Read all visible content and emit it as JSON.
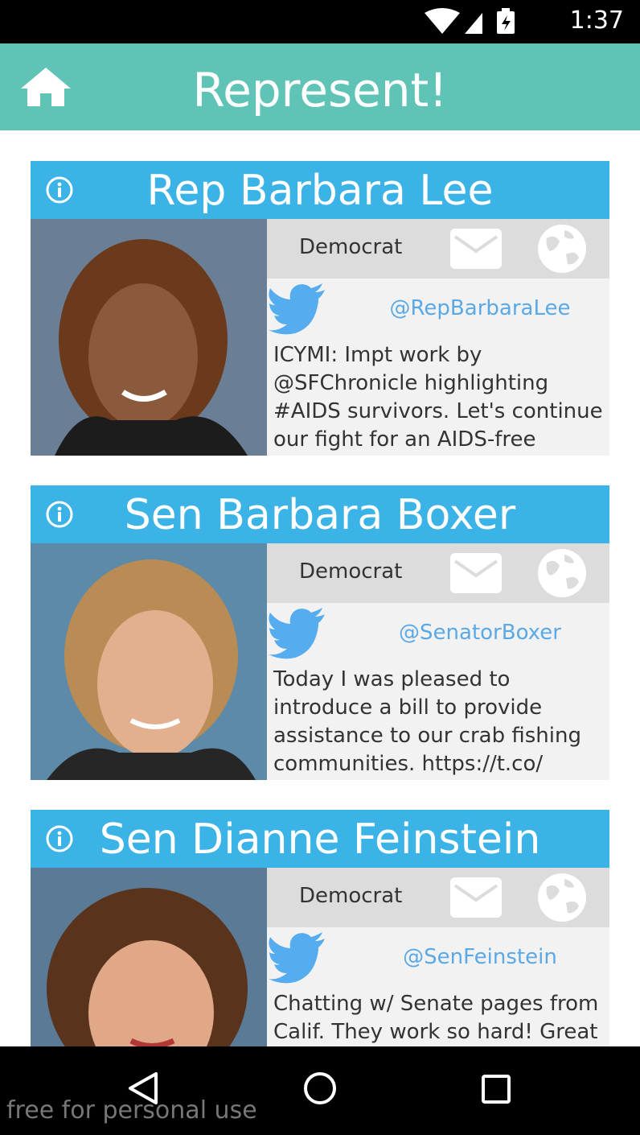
{
  "status_bar": {
    "time": "1:37"
  },
  "app_bar": {
    "title": "Represent!"
  },
  "cards": [
    {
      "name": "Rep Barbara Lee",
      "party": "Democrat",
      "handle": "@RepBarbaraLee",
      "tweet": "ICYMI: Impt work by @SFChronicle highlighting #AIDS survivors. Let's continue our fight for an AIDS-free"
    },
    {
      "name": "Sen Barbara Boxer",
      "party": "Democrat",
      "handle": "@SenatorBoxer",
      "tweet": "Today I was pleased to introduce a bill to provide assistance to our crab fishing communities. https://t.co/"
    },
    {
      "name": "Sen Dianne Feinstein",
      "party": "Democrat",
      "handle": "@SenFeinstein",
      "tweet": "Chatting w/ Senate pages from Calif. They work so hard! Great"
    }
  ],
  "watermark": "free for personal use",
  "colors": {
    "app_bar": "#5fc3b5",
    "card_header": "#3bb3e6",
    "handle": "#5aa9e6",
    "twitter": "#55acee"
  }
}
